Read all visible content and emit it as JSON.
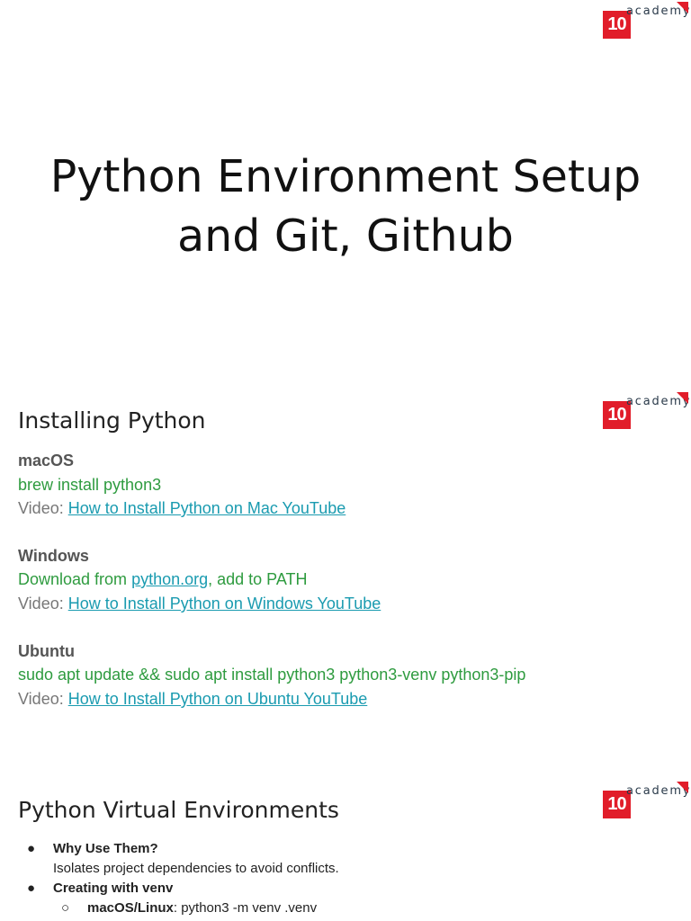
{
  "logo": {
    "badge": "10",
    "word": "academy"
  },
  "title": {
    "line1": "Python Environment Setup",
    "line2": "and Git, Github"
  },
  "installing": {
    "heading": "Installing Python",
    "video_prefix": "Video: ",
    "macos": {
      "label": "macOS",
      "command": "brew install python3",
      "video_link": "How to Install Python on Mac YouTube"
    },
    "windows": {
      "label": "Windows",
      "command_prefix": "Download from ",
      "command_link": "python.org",
      "command_suffix": ", add to PATH",
      "video_link": "How to Install Python on Windows YouTube"
    },
    "ubuntu": {
      "label": "Ubuntu",
      "command": "sudo apt update && sudo apt install python3 python3-venv python3-pip",
      "video_link": "How to Install Python on Ubuntu YouTube"
    }
  },
  "venv": {
    "heading": "Python Virtual Environments",
    "bullet_glyph": "●",
    "sub_bullet_glyph": "○",
    "items": [
      {
        "title": "Why Use Them?",
        "text": "Isolates project dependencies to avoid conflicts."
      },
      {
        "title": "Creating with venv",
        "sub": {
          "label": "macOS/Linux",
          "text": ": python3 -m venv .venv"
        }
      }
    ]
  },
  "colors": {
    "brand_red": "#e11d2a",
    "command_green": "#2e9b3f",
    "link_teal": "#1a9bb0"
  }
}
